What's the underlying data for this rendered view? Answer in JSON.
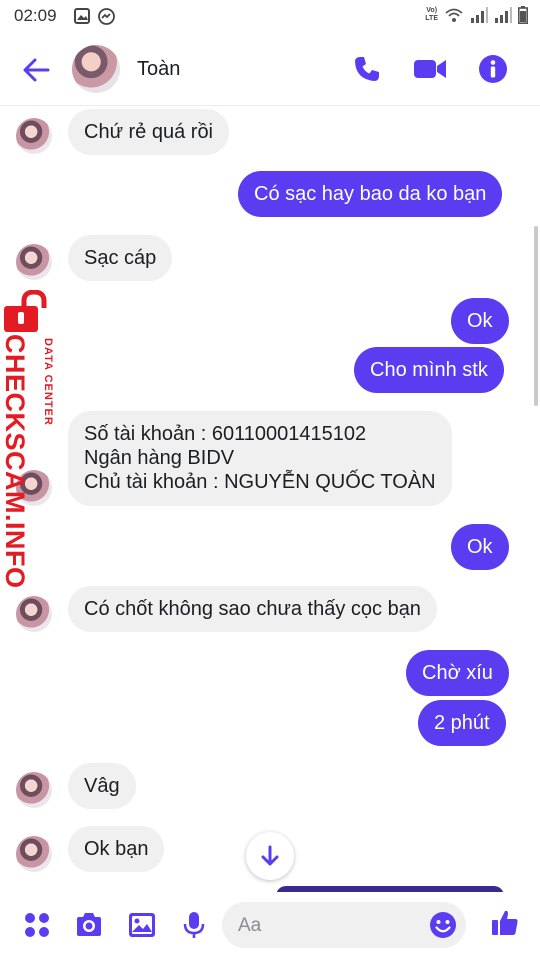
{
  "status_bar": {
    "time": "02:09",
    "network": "LTE",
    "network_top": "Vo)"
  },
  "header": {
    "contact_name": "Toàn",
    "icons": [
      "back-arrow-icon",
      "phone-icon",
      "video-camera-icon",
      "info-icon"
    ]
  },
  "watermark": {
    "brand": "CHECKSCAM.INFO",
    "subtitle": "DATA CENTER"
  },
  "messages": [
    {
      "dir": "in",
      "text": "Chứ rẻ quá rồi"
    },
    {
      "dir": "out",
      "text": "Có sạc hay bao da ko bạn"
    },
    {
      "dir": "in",
      "text": "Sạc cáp"
    },
    {
      "dir": "out",
      "text": "Ok"
    },
    {
      "dir": "out",
      "text": "Cho mình stk"
    },
    {
      "dir": "in",
      "lines": [
        "Số tài khoản : 60110001415102",
        "Ngân hàng BIDV",
        "Chủ tài khoản : NGUYỄN QUỐC TOÀN"
      ]
    },
    {
      "dir": "out",
      "text": "Ok"
    },
    {
      "dir": "in",
      "text": "Có chốt không sao chưa thấy cọc bạn"
    },
    {
      "dir": "out",
      "text": "Chờ xíu"
    },
    {
      "dir": "out",
      "text": "2 phút"
    },
    {
      "dir": "in",
      "text": "Vâg"
    },
    {
      "dir": "in",
      "text": "Ok bạn"
    }
  ],
  "composer": {
    "placeholder": "Aa",
    "icons": [
      "apps-icon",
      "camera-icon",
      "gallery-icon",
      "microphone-icon",
      "emoji-icon",
      "thumbs-up-icon"
    ]
  },
  "colors": {
    "accent": "#5b3cf0",
    "incoming_bubble": "#f0f0f0",
    "watermark": "#e31b23"
  }
}
